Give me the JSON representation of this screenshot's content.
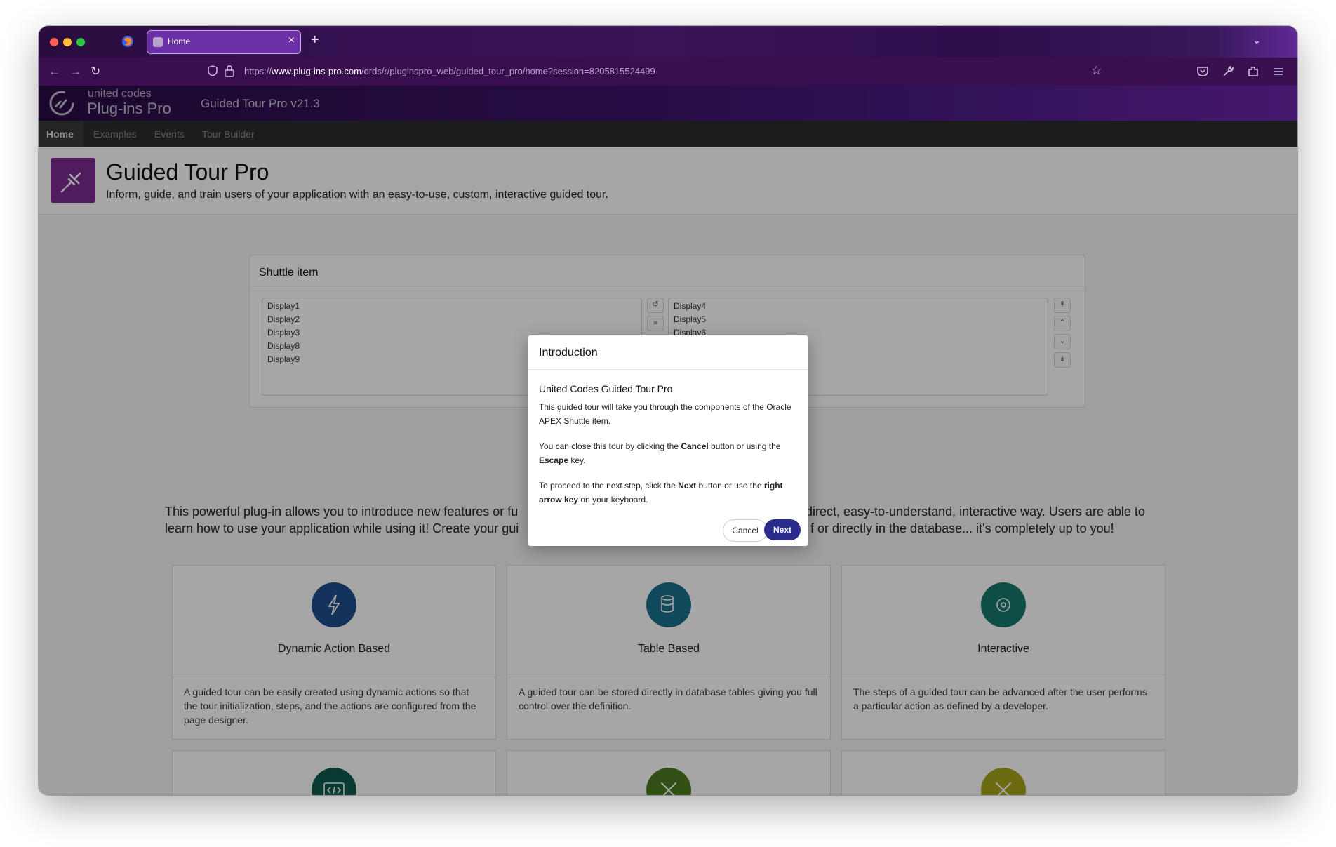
{
  "browser": {
    "tab_title": "Home",
    "tab_close": "×",
    "new_tab": "+",
    "url_domain": "www.plug-ins-pro.com",
    "url_prefix": "https://",
    "url_path": "/ords/r/pluginspro_web/guided_tour_pro/home?session=8205815524499"
  },
  "app": {
    "logo_top": "united codes",
    "logo_bottom": "Plug-ins Pro",
    "title": "Guided Tour Pro v21.3"
  },
  "nav": {
    "items": [
      {
        "label": "Home",
        "active": true
      },
      {
        "label": "Examples"
      },
      {
        "label": "Events"
      },
      {
        "label": "Tour Builder"
      }
    ]
  },
  "hero": {
    "title": "Guided Tour Pro",
    "subtitle": "Inform, guide, and train users of your application with an easy-to-use, custom, interactive guided tour."
  },
  "shuttle": {
    "title": "Shuttle item",
    "left_options": [
      "Display1",
      "Display2",
      "Display3",
      "Display8",
      "Display9"
    ],
    "right_options": [
      "Display4",
      "Display5",
      "Display6"
    ]
  },
  "intro": {
    "line1_left": "This powerful plug-in allows you to introduce new features or fu",
    "line1_right": "direct, easy-to-understand, interactive way. Users are able to",
    "line2_left": "learn how to use your application while using it! Create your gui",
    "line2_right": "f or directly in the database... it's completely up to you!"
  },
  "cards": [
    {
      "title": "Dynamic Action Based",
      "body": "A guided tour can be easily created using dynamic actions so that the tour initialization, steps, and the actions are configured from the page designer.",
      "icon": "lightning-icon",
      "color": "#1e4f8e"
    },
    {
      "title": "Table Based",
      "body": "A guided tour can be stored directly in database tables giving you full control over the definition.",
      "icon": "database-icon",
      "color": "#1a6f8e"
    },
    {
      "title": "Interactive",
      "body": "The steps of a guided tour can be advanced after the user performs a particular action as defined by a developer.",
      "icon": "gear-icon",
      "color": "#147a6e"
    },
    {
      "icon": "code-icon",
      "color": "#0f5a4e"
    },
    {
      "icon": "tools-icon",
      "color": "#4e7a22"
    },
    {
      "icon": "wrench-icon",
      "color": "#a6a51d"
    }
  ],
  "dialog": {
    "title": "Introduction",
    "heading": "United Codes Guided Tour Pro",
    "p1": "This guided tour will take you through the components of the Oracle APEX Shuttle item.",
    "p2_a": "You can close this tour by clicking the ",
    "p2_b": "Cancel",
    "p2_c": " button or using the ",
    "p2_d": "Escape",
    "p2_e": " key.",
    "p3_a": "To proceed to the next step, click the ",
    "p3_b": "Next",
    "p3_c": " button or use the ",
    "p3_d": "right arrow key",
    "p3_e": " on your keyboard.",
    "cancel": "Cancel",
    "next": "Next"
  }
}
